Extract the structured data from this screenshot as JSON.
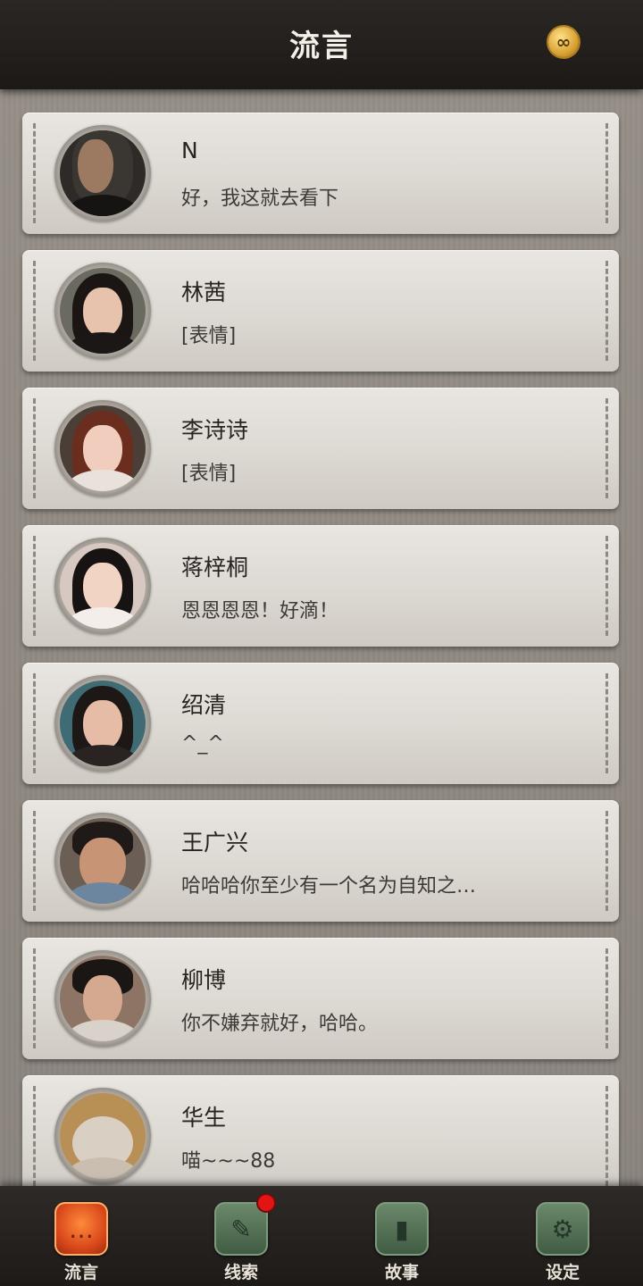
{
  "header": {
    "title": "流言",
    "coin_icon": "infinity-coin-icon",
    "coin_glyph": "∞"
  },
  "contacts": [
    {
      "name": "N",
      "message": "好，我这就去看下",
      "avatar": "man-dark-portrait"
    },
    {
      "name": "林茜",
      "message": "[表情]",
      "avatar": "woman-long-black-hair"
    },
    {
      "name": "李诗诗",
      "message": "[表情]",
      "avatar": "woman-auburn-hair"
    },
    {
      "name": "蒋梓桐",
      "message": "恩恩恩恩！好滴！",
      "avatar": "woman-dark-hair"
    },
    {
      "name": "绍清",
      "message": "^_^",
      "avatar": "woman-long-hair"
    },
    {
      "name": "王广兴",
      "message": "哈哈哈你至少有一个名为自知之…",
      "avatar": "man-glasses"
    },
    {
      "name": "柳博",
      "message": "你不嫌弃就好，哈哈。",
      "avatar": "man-slick-hair"
    },
    {
      "name": "华生",
      "message": "喵~~~88",
      "avatar": "cat"
    }
  ],
  "tabs": [
    {
      "label": "流言",
      "icon": "chat-bubble-icon",
      "glyph": "…",
      "active": true,
      "badge": false
    },
    {
      "label": "线索",
      "icon": "notes-icon",
      "glyph": "✎",
      "active": false,
      "badge": true
    },
    {
      "label": "故事",
      "icon": "book-icon",
      "glyph": "▮",
      "active": false,
      "badge": false
    },
    {
      "label": "设定",
      "icon": "gear-icon",
      "glyph": "⚙",
      "active": false,
      "badge": false
    }
  ],
  "colors": {
    "accent": "#e5531f",
    "badge": "#e31414",
    "card": "#e2ded8",
    "bar": "#24201d"
  }
}
